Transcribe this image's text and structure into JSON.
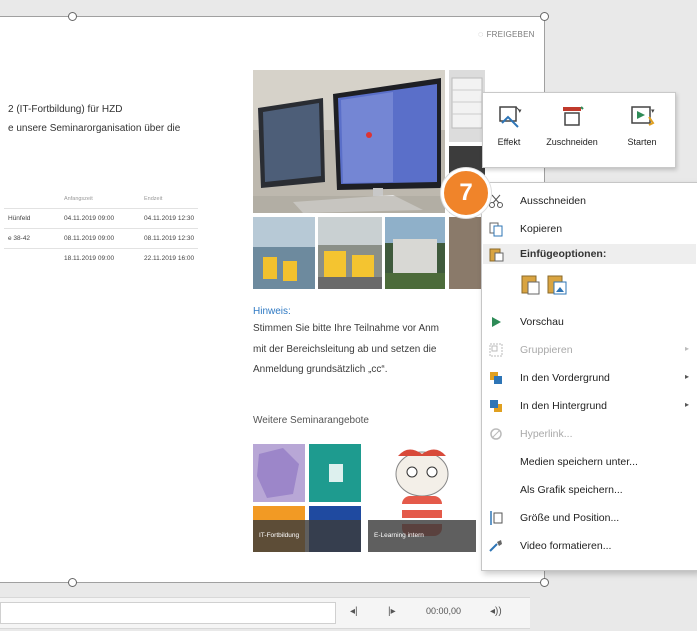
{
  "slide": {
    "share_label": "FREIGEBEN",
    "title_line1": "2 (IT-Fortbildung) für HZD",
    "title_line2": "e unsere Seminarorganisation über die",
    "table": {
      "headers": [
        "",
        "Anfangszeit",
        "Endzeit"
      ],
      "rows": [
        [
          "Hünfeld",
          "04.11.2019 09:00",
          "04.11.2019 12:30"
        ],
        [
          "e 38-42",
          "08.11.2019 09:00",
          "08.11.2019 12:30"
        ],
        [
          "",
          "18.11.2019 09:00",
          "22.11.2019 16:00"
        ]
      ]
    },
    "hinweis_title": "Hinweis:",
    "hinweis_lines": [
      "Stimmen Sie bitte Ihre Teilnahme vor Anm",
      "mit der Bereichsleitung ab und setzen die",
      "Anmeldung grundsätzlich „cc“."
    ],
    "weitere_title": "Weitere Seminarangebote",
    "tiles": [
      {
        "label": "IT-Fortbildung"
      },
      {
        "label": "E-Learning intern"
      }
    ]
  },
  "ribbon": {
    "buttons": [
      {
        "label": "Effekt",
        "icon": "effect-icon"
      },
      {
        "label": "Zuschneiden",
        "icon": "crop-icon"
      },
      {
        "label": "Starten",
        "icon": "start-icon"
      }
    ]
  },
  "step_badge": "7",
  "context_menu": {
    "cut": "Ausschneiden",
    "copy": "Kopieren",
    "paste_options_header": "Einfügeoptionen:",
    "preview": "Vorschau",
    "group": "Gruppieren",
    "bring_forward": "In den Vordergrund",
    "send_backward": "In den Hintergrund",
    "hyperlink": "Hyperlink...",
    "save_media": "Medien speichern unter...",
    "save_as_picture": "Als Grafik speichern...",
    "size_position": "Größe und Position...",
    "format_video": "Video formatieren..."
  },
  "media_bar": {
    "time": "00:00,00"
  },
  "colors": {
    "badge": "#f0842a",
    "hinweis": "#2e79c3",
    "play": "#2e8b57"
  }
}
